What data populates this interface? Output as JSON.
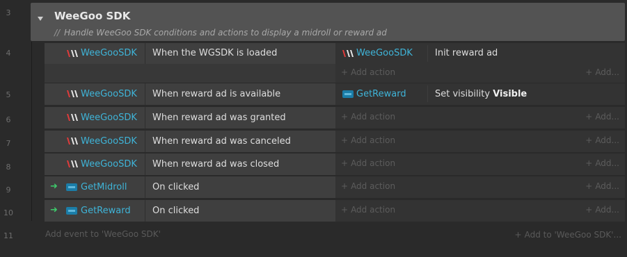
{
  "line_numbers": [
    "3",
    "4",
    "5",
    "6",
    "7",
    "8",
    "9",
    "10",
    "11"
  ],
  "group": {
    "title": "WeeGoo SDK",
    "comment_marker": "//",
    "comment": "Handle WeeGoo SDK conditions and actions to display a midroll or reward ad"
  },
  "events": [
    {
      "line": "4",
      "condition_object": "WeeGooSDK",
      "condition_text": "When the WGSDK is loaded",
      "action_object": "WeeGooSDK",
      "action_text": "Init reward ad"
    },
    {
      "line": "5",
      "condition_object": "WeeGooSDK",
      "condition_text": "When reward ad is available",
      "action_object": "GetReward",
      "action_text": "Set visibility ",
      "action_value": "Visible"
    },
    {
      "line": "6",
      "condition_object": "WeeGooSDK",
      "condition_text": "When reward ad was granted"
    },
    {
      "line": "7",
      "condition_object": "WeeGooSDK",
      "condition_text": "When reward ad was canceled"
    },
    {
      "line": "8",
      "condition_object": "WeeGooSDK",
      "condition_text": "When reward ad was closed"
    },
    {
      "line": "9",
      "condition_object": "GetMidroll",
      "condition_text": "On clicked"
    },
    {
      "line": "10",
      "condition_object": "GetReward",
      "condition_text": "On clicked"
    }
  ],
  "labels": {
    "add_action": "Add action",
    "add_more": "Add...",
    "add_event": "Add event to 'WeeGoo SDK'",
    "add_to": "Add to 'WeeGoo SDK'..."
  },
  "colors": {
    "object_text": "#3fb4d8",
    "trigger_arrow": "#3ec66a",
    "group_bg": "#535353"
  }
}
